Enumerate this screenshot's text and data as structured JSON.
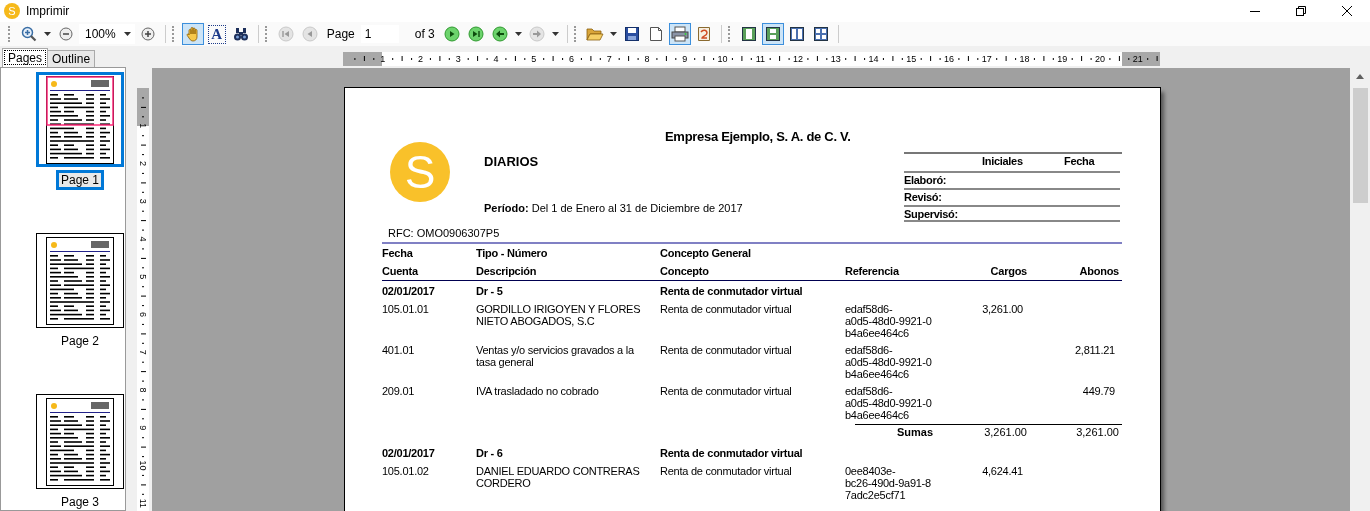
{
  "window": {
    "app_icon_letter": "S",
    "title": "Imprimir"
  },
  "toolbar": {
    "zoom": {
      "value": "100%"
    },
    "hand_tool": {
      "selected": true
    },
    "text_tool": {
      "label": "A",
      "selected": false
    },
    "first_page": {
      "disabled": true
    },
    "previous_page": {
      "disabled": true
    },
    "page_label": "Page",
    "page_input": "1",
    "page_total": "of 3",
    "next_page": {
      "disabled": false
    },
    "last_page": {
      "disabled": false
    },
    "back": {
      "disabled": false
    },
    "forward": {
      "disabled": true
    },
    "print": {
      "selected": true
    },
    "view_modes": [
      {
        "selected": false
      },
      {
        "selected": true
      },
      {
        "selected": false
      },
      {
        "selected": false
      }
    ]
  },
  "side_panel": {
    "tabs": [
      {
        "label": "Pages",
        "selected": true
      },
      {
        "label": "Outline",
        "selected": false
      }
    ],
    "thumbnails": [
      {
        "label": "Page 1",
        "selected": true
      },
      {
        "label": "Page 2",
        "selected": false
      },
      {
        "label": "Page 3",
        "selected": false
      }
    ]
  },
  "rulers": {
    "horizontal": [
      "1",
      "2",
      "3",
      "4",
      "5",
      "6",
      "7",
      "8",
      "9",
      "10",
      "11",
      "12",
      "13",
      "14",
      "15",
      "16",
      "17",
      "18",
      "19",
      "20",
      "21"
    ],
    "vertical": [
      "1",
      "2",
      "3",
      "4",
      "5",
      "6",
      "7",
      "8",
      "9",
      "10",
      "11"
    ]
  },
  "report": {
    "logo_letter": "S",
    "company": "Empresa Ejemplo, S. A. de C. V.",
    "title": "DIARIOS",
    "period": "**Período:** Del 1 de Enero al 31 de Diciembre de 2017",
    "signoff": {
      "columns": [
        "Iniciales",
        "Fecha"
      ],
      "rows": [
        "Elaboró:",
        "Revisó:",
        "Supervisó:"
      ]
    },
    "rfc": "RFC: OMO0906307P5",
    "header_rows": [
      [
        "Fecha",
        "Tipo - Número",
        "Concepto General"
      ],
      [
        "Cuenta",
        "Descripción",
        "Concepto",
        "Referencia",
        "Cargos",
        "Abonos"
      ]
    ],
    "polizas": [
      {
        "fecha": "02/01/2017",
        "tipo": "Dr - 5",
        "concepto": "Renta de conmutador virtual",
        "entries": [
          {
            "cuenta": "105.01.01",
            "descripcion": "GORDILLO IRIGOYEN Y FLORES NIETO ABOGADOS, S.C",
            "concepto": "Renta de conmutador virtual",
            "referencia": "edaf58d6-\na0d5-48d0-9921-0\nb4a6ee464c6",
            "cargos": "3,261.00"
          },
          {
            "cuenta": "401.01",
            "descripcion": "Ventas y/o servicios gravados a la tasa general",
            "concepto": "Renta de conmutador virtual",
            "referencia": "edaf58d6-\na0d5-48d0-9921-0\nb4a6ee464c6",
            "abonos": "2,811.21"
          },
          {
            "cuenta": "209.01",
            "descripcion": "IVA trasladado no cobrado",
            "concepto": "Renta de conmutador virtual",
            "referencia": "edaf58d6-\na0d5-48d0-9921-0\nb4a6ee464c6",
            "abonos": "449.79"
          }
        ],
        "totals": {
          "label": "Sumas",
          "cargos": "3,261.00",
          "abonos": "3,261.00"
        }
      },
      {
        "fecha": "02/01/2017",
        "tipo": "Dr - 6",
        "concepto": "Renta de conmutador virtual",
        "entries": [
          {
            "cuenta": "105.01.02",
            "descripcion": "DANIEL EDUARDO CONTRERAS CORDERO",
            "concepto": "Renta de conmutador virtual",
            "referencia": "0ee8403e-\nbc26-490d-9a91-8\n7adc2e5cf71",
            "cargos": "4,624.41"
          }
        ]
      }
    ]
  }
}
